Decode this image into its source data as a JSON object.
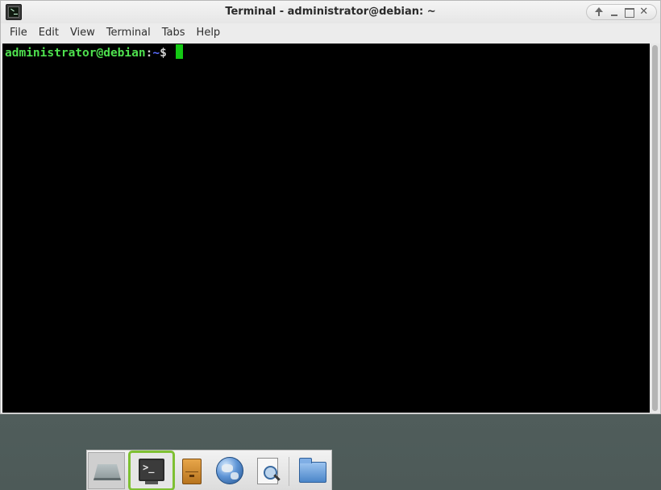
{
  "window": {
    "title": "Terminal - administrator@debian: ~",
    "icon": "terminal-icon"
  },
  "menubar": {
    "items": [
      "File",
      "Edit",
      "View",
      "Terminal",
      "Tabs",
      "Help"
    ]
  },
  "terminal": {
    "user_host": "administrator@debian",
    "separator": ":",
    "path": "~",
    "prompt_symbol": "$ ",
    "colors": {
      "user_host": "#4ee04e",
      "path": "#5a6cff",
      "cursor": "#14c914",
      "background": "#000000"
    }
  },
  "dock": {
    "items": [
      {
        "icon": "show-desktop-icon",
        "state": "pressed"
      },
      {
        "icon": "terminal-icon",
        "state": "focused"
      },
      {
        "icon": "archive-manager-icon"
      },
      {
        "icon": "web-browser-icon"
      },
      {
        "icon": "search-files-icon"
      },
      {
        "icon": "file-manager-folder-icon"
      }
    ],
    "focus_color": "#7ec032"
  }
}
